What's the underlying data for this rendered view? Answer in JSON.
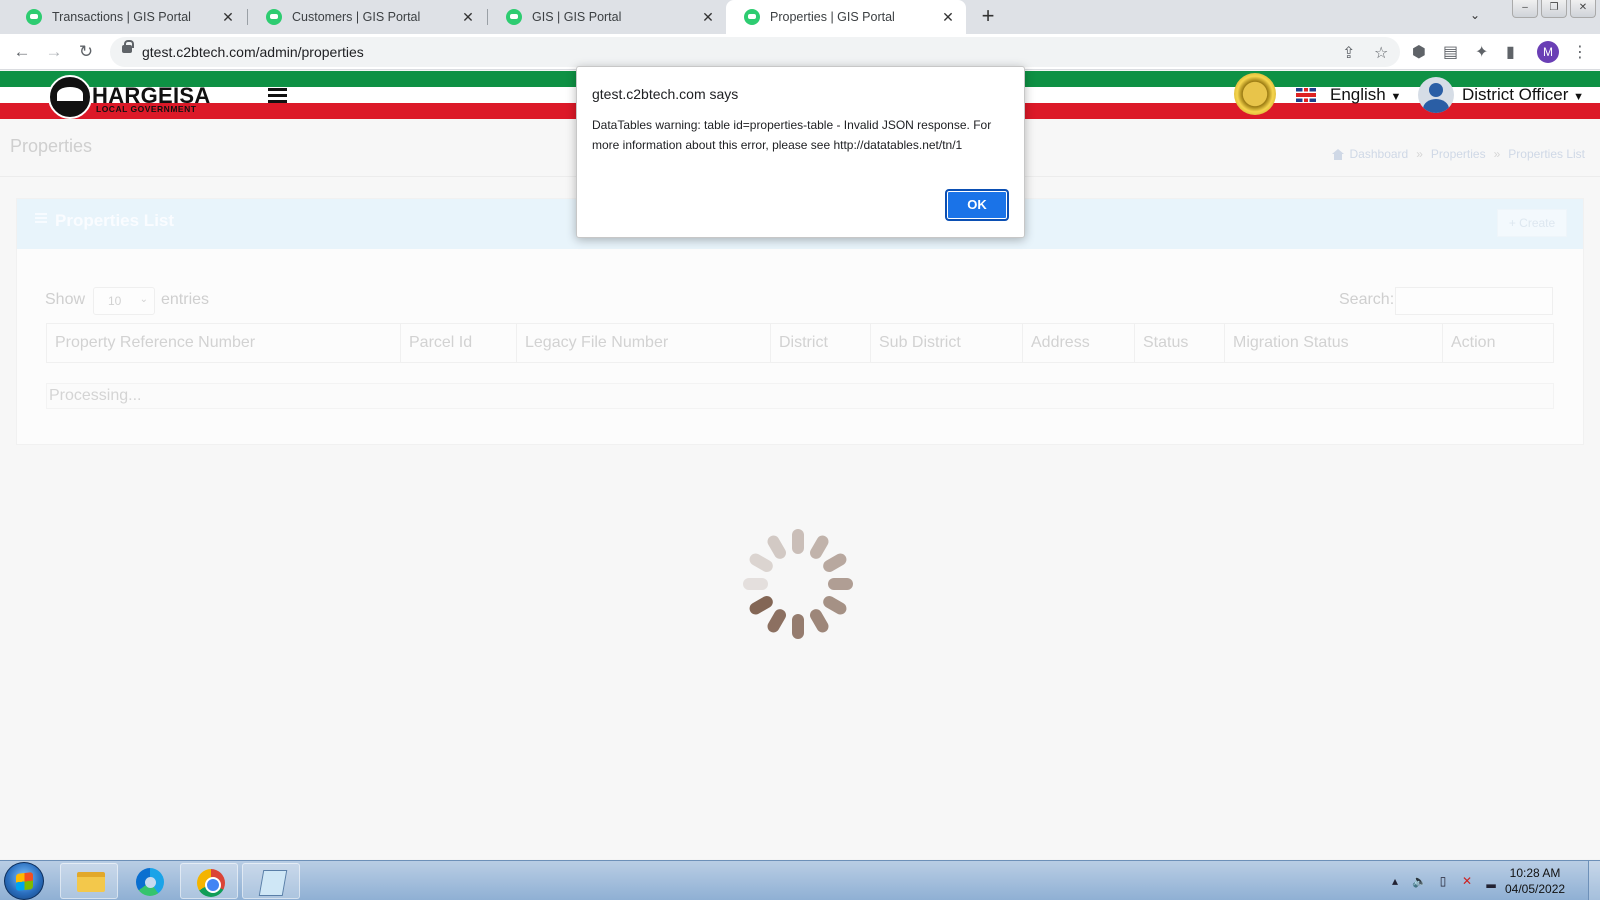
{
  "browser": {
    "tabs": [
      {
        "title": "Transactions | GIS Portal",
        "active": false
      },
      {
        "title": "Customers | GIS Portal",
        "active": false
      },
      {
        "title": "GIS | GIS Portal",
        "active": false
      },
      {
        "title": "Properties | GIS Portal",
        "active": true
      }
    ],
    "url": "gtest.c2btech.com/admin/properties",
    "profile_initial": "M"
  },
  "header": {
    "logo_title": "HARGEISA",
    "logo_subtitle": "LOCAL GOVERNMENT",
    "language": "English",
    "user": "District Officer"
  },
  "page": {
    "title": "Properties",
    "breadcrumb": [
      "Dashboard",
      "Properties",
      "Properties List"
    ]
  },
  "box": {
    "title": "Properties List",
    "create_label": "Create"
  },
  "table": {
    "show_label": "Show",
    "page_size": "10",
    "entries_label": "entries",
    "search_label": "Search:",
    "search_value": "",
    "columns": [
      "Property Reference Number",
      "Parcel Id",
      "Legacy File Number",
      "District",
      "Sub District",
      "Address",
      "Status",
      "Migration Status",
      "Action"
    ],
    "processing_text": "Processing..."
  },
  "alert": {
    "origin": "gtest.c2btech.com says",
    "message": "DataTables warning: table id=properties-table - Invalid JSON response. For more information about this error, please see http://datatables.net/tn/1",
    "ok_label": "OK"
  },
  "taskbar": {
    "time": "10:28 AM",
    "date": "04/05/2022"
  },
  "colors": {
    "flag_green": "#0e9144",
    "flag_red": "#dc1928",
    "ok_button": "#1a73e8",
    "spinner": "#7a5a48"
  }
}
